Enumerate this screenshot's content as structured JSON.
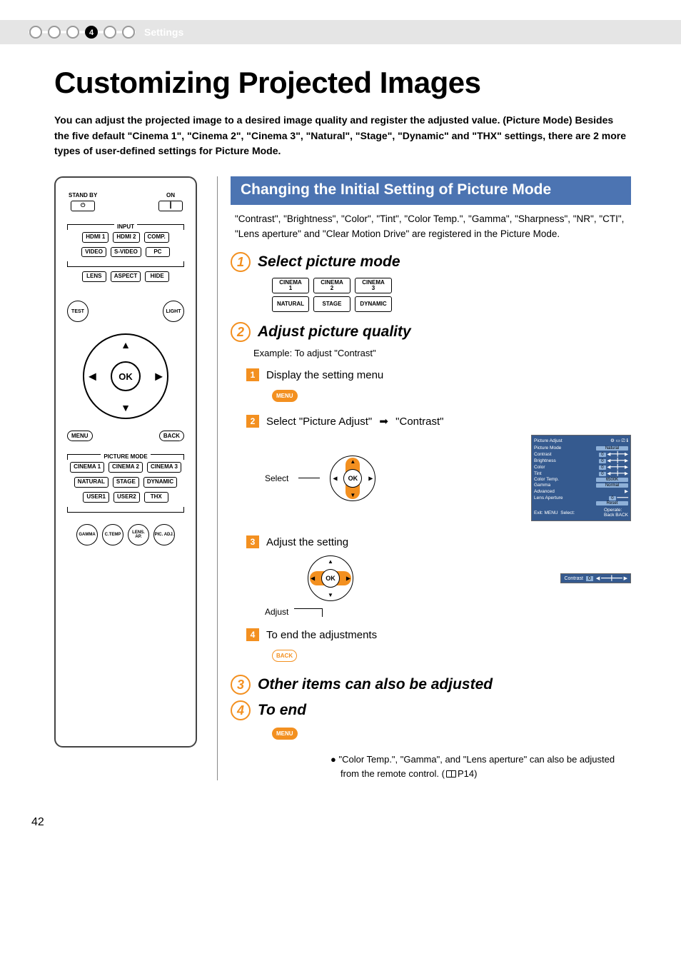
{
  "header": {
    "chapter_number": "4",
    "section_label": "Settings"
  },
  "title": "Customizing Projected Images",
  "intro_parts": {
    "pre": "You can adjust the projected image to a desired image quality and register the adjusted value. (Picture Mode) Besides the five default ",
    "list": [
      "Cinema 1",
      "Cinema 2",
      "Cinema 3",
      "Natural",
      "Stage",
      "Dynamic",
      "THX"
    ],
    "joiner_and": " and ",
    "post": " settings, there are 2 more types of user-defined settings for Picture Mode."
  },
  "remote": {
    "standby": "STAND BY",
    "on": "ON",
    "input_label": "INPUT",
    "inputs_row1": [
      "HDMI 1",
      "HDMI 2",
      "COMP."
    ],
    "inputs_row2": [
      "VIDEO",
      "S-VIDEO",
      "PC"
    ],
    "row3": [
      "LENS",
      "ASPECT",
      "HIDE"
    ],
    "test": "TEST",
    "light": "LIGHT",
    "ok": "OK",
    "menu": "MENU",
    "back": "BACK",
    "picture_mode_label": "PICTURE MODE",
    "pm_row1": [
      "CINEMA 1",
      "CINEMA 2",
      "CINEMA 3"
    ],
    "pm_row2": [
      "NATURAL",
      "STAGE",
      "DYNAMIC"
    ],
    "pm_row3": [
      "USER1",
      "USER2",
      "THX"
    ],
    "bottom_round": [
      "GAMMA",
      "C.TEMP",
      "LENS. AP.",
      "PIC. ADJ."
    ]
  },
  "section_heading": "Changing the Initial Setting of Picture Mode",
  "lead": "\"Contrast\", \"Brightness\", \"Color\", \"Tint\", \"Color Temp.\", \"Gamma\", \"Sharpness\", \"NR\", \"CTI\", \"Lens aperture\" and \"Clear Motion Drive\" are registered in the Picture Mode.",
  "steps": {
    "s1": {
      "num": "1",
      "title": "Select picture mode"
    },
    "s2": {
      "num": "2",
      "title": "Adjust picture quality",
      "example": "Example: To adjust \"Contrast\"",
      "sub1": "Display the setting menu",
      "sub2_pre": "Select \"Picture Adjust\"",
      "sub2_post": "\"Contrast\"",
      "sub3": "Adjust the setting",
      "sub4": "To end the adjustments"
    },
    "s3": {
      "num": "3",
      "title": "Other items can also be adjusted"
    },
    "s4": {
      "num": "4",
      "title": "To end"
    }
  },
  "mode_buttons_r1": [
    "CINEMA 1",
    "CINEMA 2",
    "CINEMA 3"
  ],
  "mode_buttons_r2": [
    "NATURAL",
    "STAGE",
    "DYNAMIC"
  ],
  "labels": {
    "select": "Select",
    "adjust": "Adjust",
    "menu": "MENU",
    "back": "BACK",
    "ok": "OK"
  },
  "osd": {
    "title": "Picture Adjust",
    "picture_mode_label": "Picture Mode",
    "picture_mode_value": "Natural",
    "rows": [
      {
        "k": "Contrast",
        "v": "0"
      },
      {
        "k": "Brightness",
        "v": "0"
      },
      {
        "k": "Color",
        "v": "0"
      },
      {
        "k": "Tint",
        "v": "0"
      }
    ],
    "color_temp_label": "Color Temp.",
    "color_temp_value": "6500K",
    "gamma_label": "Gamma",
    "gamma_value": "Normal",
    "advanced": "Advanced",
    "lens_ap_label": "Lens Aperture",
    "lens_ap_value": "0",
    "reset": "Reset",
    "exit": "Exit:",
    "exit_btn": "MENU",
    "select_lbl": "Select:",
    "operate": "Operate:",
    "back_lbl": "Back",
    "back_btn": "BACK"
  },
  "osd_mini": {
    "label": "Contrast",
    "value": "0"
  },
  "footnote": "\"Color Temp.\", \"Gamma\", and \"Lens aperture\" can also be adjusted from the remote control. (",
  "footnote_ref": "P14)",
  "page_number": "42"
}
